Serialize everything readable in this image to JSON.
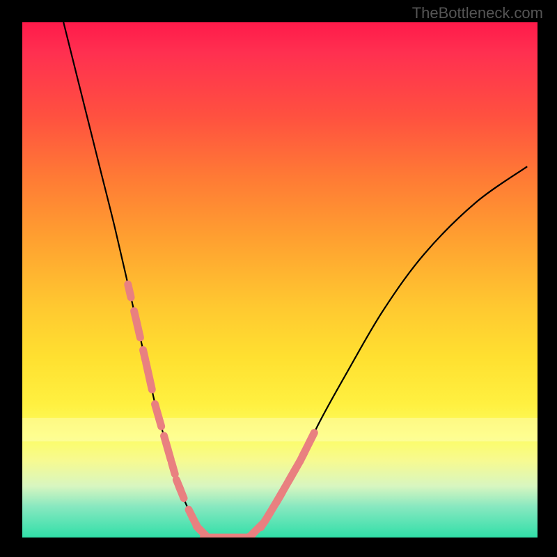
{
  "attribution": "TheBottleneck.com",
  "chart_data": {
    "type": "line",
    "title": "",
    "xlabel": "",
    "ylabel": "",
    "xlim": [
      0,
      100
    ],
    "ylim": [
      0,
      100
    ],
    "series": [
      {
        "name": "left-arm",
        "x": [
          8,
          10,
          12,
          15,
          18,
          21,
          24,
          26,
          28,
          30,
          32,
          34,
          36
        ],
        "y": [
          100,
          92,
          84,
          72,
          60,
          47,
          34,
          25,
          18,
          11,
          6,
          2,
          0
        ]
      },
      {
        "name": "valley-floor",
        "x": [
          36,
          40,
          44
        ],
        "y": [
          0,
          0,
          0
        ]
      },
      {
        "name": "right-arm",
        "x": [
          44,
          47,
          50,
          54,
          58,
          63,
          70,
          78,
          88,
          98
        ],
        "y": [
          0,
          3,
          8,
          15,
          23,
          32,
          44,
          55,
          65,
          72
        ]
      }
    ],
    "markers": [
      {
        "name": "left-cluster-upper",
        "x_range": [
          21,
          25
        ],
        "y_range": [
          25,
          47
        ]
      },
      {
        "name": "left-cluster-lower",
        "x_range": [
          26,
          31
        ],
        "y_range": [
          6,
          22
        ]
      },
      {
        "name": "valley-cluster",
        "x_range": [
          33,
          46
        ],
        "y_range": [
          0,
          2
        ]
      },
      {
        "name": "right-cluster-lower",
        "x_range": [
          46,
          50
        ],
        "y_range": [
          3,
          10
        ]
      },
      {
        "name": "right-cluster-upper",
        "x_range": [
          50,
          56
        ],
        "y_range": [
          12,
          27
        ]
      }
    ],
    "colors": {
      "curve": "#000000",
      "marker": "#e98080",
      "gradient_top": "#ff1a4a",
      "gradient_mid": "#ffd030",
      "gradient_bottom": "#30dfa8"
    }
  }
}
